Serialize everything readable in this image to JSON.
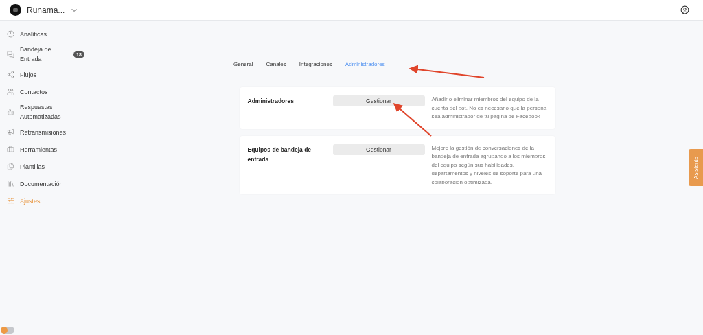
{
  "header": {
    "workspace": "Runama..."
  },
  "sidebar": {
    "items": [
      {
        "label": "Analíticas",
        "selected": false
      },
      {
        "label": "Bandeja de Entrada",
        "selected": false,
        "badge": "18"
      },
      {
        "label": "Flujos",
        "selected": false
      },
      {
        "label": "Contactos",
        "selected": false
      },
      {
        "label": "Respuestas Automatizadas",
        "selected": false
      },
      {
        "label": "Retransmisiones",
        "selected": false
      },
      {
        "label": "Herramientas",
        "selected": false
      },
      {
        "label": "Plantillas",
        "selected": false
      },
      {
        "label": "Documentación",
        "selected": false
      },
      {
        "label": "Ajustes",
        "selected": true
      }
    ]
  },
  "tabs": [
    {
      "label": "General",
      "selected": false
    },
    {
      "label": "Canales",
      "selected": false
    },
    {
      "label": "Integraciones",
      "selected": false
    },
    {
      "label": "Administradores",
      "selected": true
    }
  ],
  "cards": [
    {
      "title": "Administradores",
      "button": "Gestionar",
      "description": "Añadir o eliminar miembros del equipo de la cuenta del bot. No es necesario que la persona sea administrador de tu página de Facebook"
    },
    {
      "title": "Equipos de bandeja de entrada",
      "button": "Gestionar",
      "description": "Mejore la gestión de conversaciones de la bandeja de entrada agrupando a los miembros del equipo según sus habilidades, departamentos y niveles de soporte para una colaboración optimizada."
    }
  ],
  "assistant_tab": "Asistente",
  "theme_toggle": {
    "on": false
  }
}
